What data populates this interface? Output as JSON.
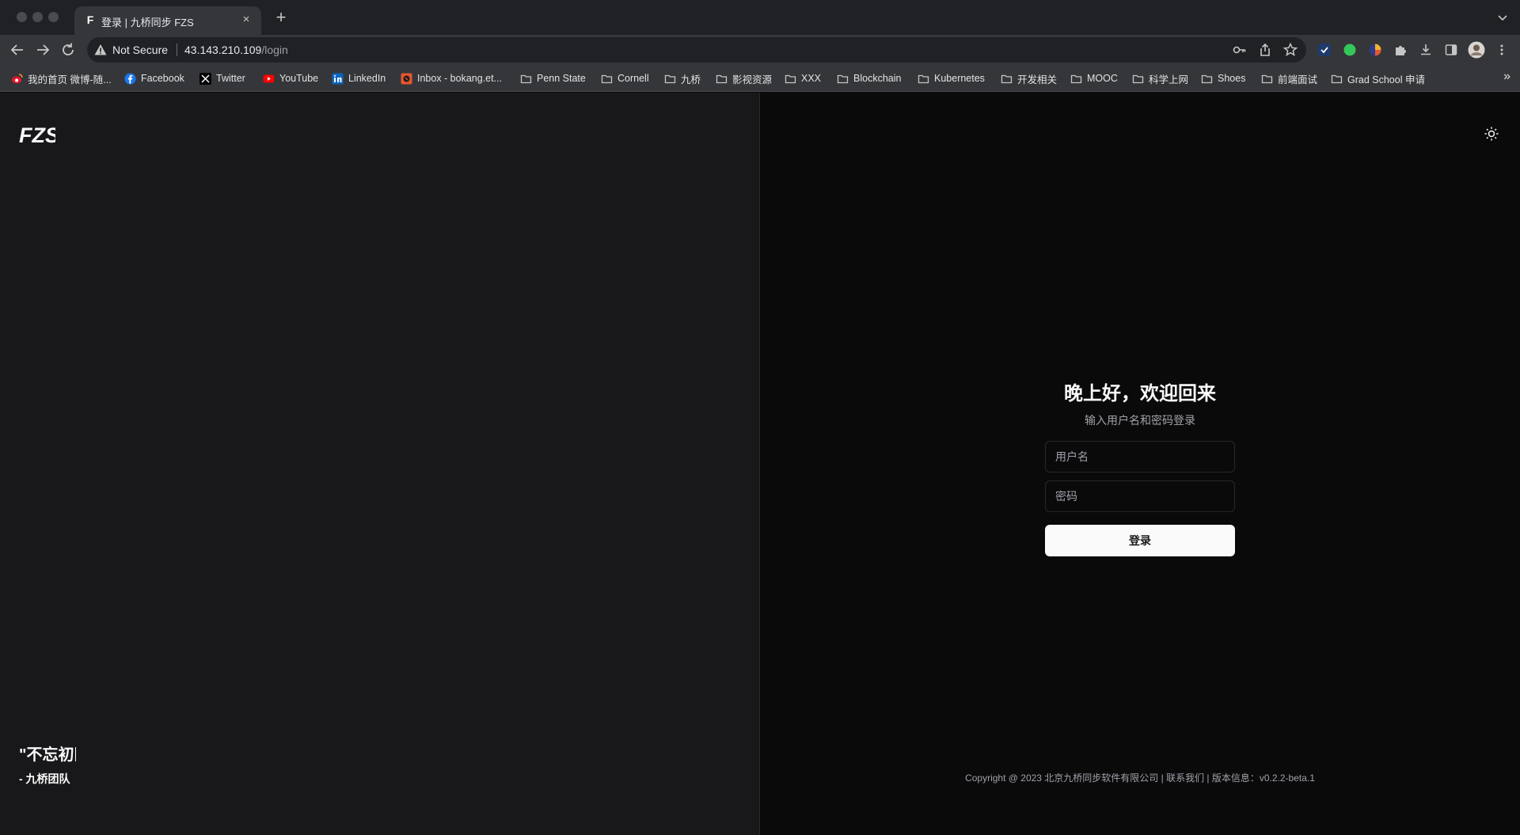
{
  "browser": {
    "tab_title": "登录 | 九桥同步 FZS",
    "tab_favicon": "F",
    "tab_close": "×",
    "new_tab": "+",
    "security_label": "Not Secure",
    "url_host": "43.143.210.109",
    "url_path": "/login",
    "bookmarks": [
      {
        "label": "我的首页 微博-随...",
        "icon": "weibo-icon"
      },
      {
        "label": "Facebook",
        "icon": "facebook-icon"
      },
      {
        "label": "Twitter",
        "icon": "x-twitter-icon"
      },
      {
        "label": "YouTube",
        "icon": "youtube-icon"
      },
      {
        "label": "LinkedIn",
        "icon": "linkedin-icon"
      },
      {
        "label": "Inbox - bokang.et...",
        "icon": "mail-icon"
      },
      {
        "label": "Penn State",
        "icon": "folder-icon"
      },
      {
        "label": "Cornell",
        "icon": "folder-icon"
      },
      {
        "label": "九桥",
        "icon": "folder-icon"
      },
      {
        "label": "影视资源",
        "icon": "folder-icon"
      },
      {
        "label": "XXX",
        "icon": "folder-icon"
      },
      {
        "label": "Blockchain",
        "icon": "folder-icon"
      },
      {
        "label": "Kubernetes",
        "icon": "folder-icon"
      },
      {
        "label": "开发相关",
        "icon": "folder-icon"
      },
      {
        "label": "MOOC",
        "icon": "folder-icon"
      },
      {
        "label": "科学上网",
        "icon": "folder-icon"
      },
      {
        "label": "Shoes",
        "icon": "folder-icon"
      },
      {
        "label": "前端面试",
        "icon": "folder-icon"
      },
      {
        "label": "Grad School 申请",
        "icon": "folder-icon"
      }
    ],
    "bookmarks_more": "»"
  },
  "page": {
    "logo_text": "FZS",
    "quote": "\"不忘初",
    "quote_author": "- 九桥团队",
    "login": {
      "title": "晚上好，欢迎回来",
      "subtitle": "输入用户名和密码登录",
      "username_placeholder": "用户名",
      "password_placeholder": "密码",
      "submit_label": "登录"
    },
    "footer": "Copyright @ 2023 北京九桥同步软件有限公司 | 联系我们 | 版本信息：v0.2.2-beta.1"
  },
  "colors": {
    "left_panel_bg": "#18181b",
    "right_panel_bg": "#0a0a0b",
    "text_primary": "#fafafa",
    "text_muted": "#a1a1aa",
    "button_bg": "#fafafa"
  }
}
